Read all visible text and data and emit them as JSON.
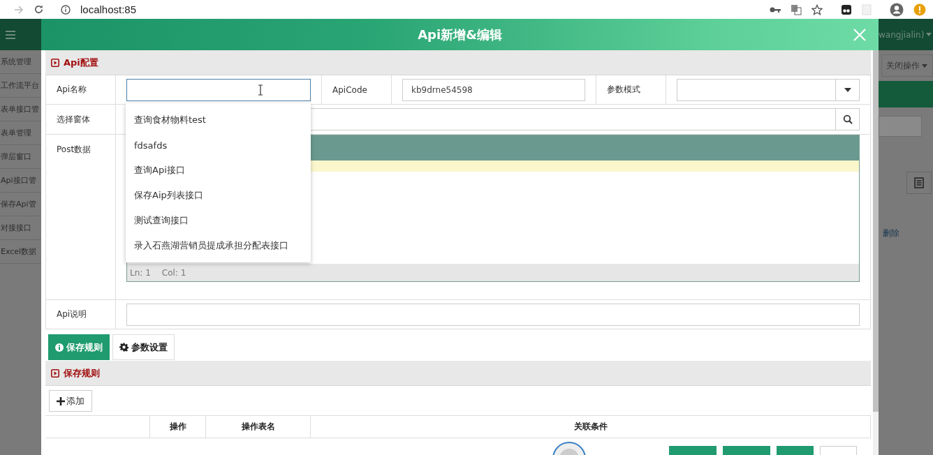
{
  "browser": {
    "address": "localhost:85"
  },
  "background": {
    "menu_items": [
      "系统管理",
      "工作流平台",
      "表单接口管",
      "表单管理",
      "弹层窗口",
      "Api接口管",
      "保存Api管",
      "对接接口",
      "Excel数据"
    ],
    "user": "wangjialin)",
    "close_menu": "关闭操作",
    "delete_link": "删除"
  },
  "dialog": {
    "title": "Api新增&编辑",
    "config_section": {
      "title": "Api配置"
    },
    "form": {
      "api_name": {
        "label": "Api名称",
        "focused": true
      },
      "api_code": {
        "label": "ApiCode",
        "value": "kb9drne54598"
      },
      "param_mode": {
        "label": "参数模式"
      },
      "form_select": {
        "label": "选择窗体"
      },
      "post_data": {
        "label": "Post数据",
        "status": [
          "Ln: 1",
          "Col: 1"
        ]
      },
      "description": {
        "label": "Api说明"
      }
    },
    "suggestions": [
      "查询食材物料test",
      "fdsafds",
      "查询Api接口",
      "保存Aip列表接口",
      "测试查询接口",
      "录入石燕湖营销员提成承担分配表接口"
    ],
    "tabs": [
      {
        "label": "保存规则",
        "selected": true,
        "kind": "info"
      },
      {
        "label": "参数设置",
        "selected": false,
        "kind": "gear"
      }
    ],
    "rules_section": {
      "title": "保存规则",
      "add_button": "添加"
    },
    "table": {
      "columns": [
        "操作",
        "操作表名",
        "关联条件"
      ]
    },
    "footer_buttons": [
      {
        "kind": "primary"
      },
      {
        "kind": "primary"
      },
      {
        "kind": "primary"
      },
      {
        "kind": "default"
      }
    ]
  }
}
